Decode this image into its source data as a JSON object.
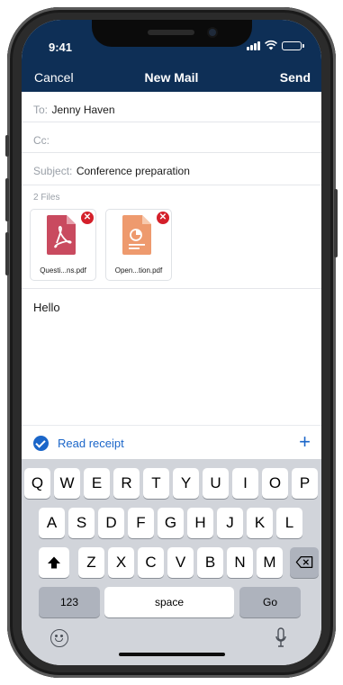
{
  "status": {
    "time": "9:41"
  },
  "nav": {
    "cancel_label": "Cancel",
    "title": "New Mail",
    "send_label": "Send"
  },
  "compose": {
    "to_label": "To:",
    "to_value": "Jenny Haven",
    "cc_label": "Cc:",
    "subject_label": "Subject:",
    "subject_value": "Conference preparation",
    "files_count": "2 Files",
    "attachments": [
      {
        "name": "Questi...ns.pdf",
        "icon": "pdf-file-icon",
        "color": "#c94a5f"
      },
      {
        "name": "Open...tion.pdf",
        "icon": "presentation-file-icon",
        "color": "#ee9a6e"
      }
    ],
    "body_text": "Hello"
  },
  "receipt": {
    "label": "Read receipt",
    "checked": true,
    "add_label": "+"
  },
  "keyboard": {
    "row1": [
      "Q",
      "W",
      "E",
      "R",
      "T",
      "Y",
      "U",
      "I",
      "O",
      "P"
    ],
    "row2": [
      "A",
      "S",
      "D",
      "F",
      "G",
      "H",
      "J",
      "K",
      "L"
    ],
    "row3": [
      "Z",
      "X",
      "C",
      "V",
      "B",
      "N",
      "M"
    ],
    "numbers_label": "123",
    "space_label": "space",
    "go_label": "Go"
  },
  "colors": {
    "header": "#0e2f56",
    "accent": "#1b66c9",
    "remove": "#d4202a"
  }
}
